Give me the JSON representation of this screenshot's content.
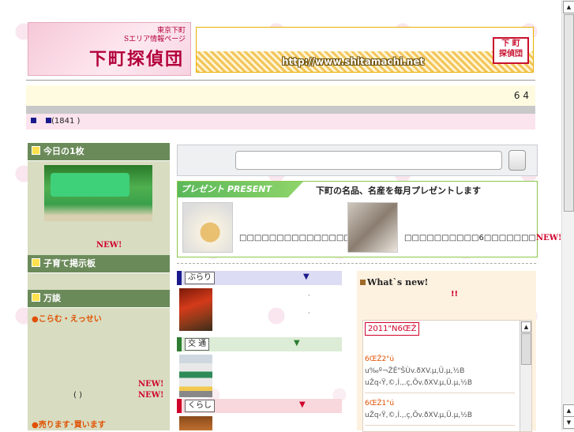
{
  "header": {
    "logo_sub_line1": "東京下町",
    "logo_sub_line2": "Sエリア情報ページ",
    "logo_main": "下町探偵団",
    "banner_url": "http://www.shitamachi.net",
    "banner_stamp_line1": "下 町",
    "banner_stamp_line2": "探偵団"
  },
  "counter": {
    "value": "6 4"
  },
  "info_bar": {
    "text": "(1841 )"
  },
  "left": {
    "today_title": "今日の1枚",
    "today_new": "NEW!",
    "board_title": "子育て掲示板",
    "talk_title": "万談",
    "column_label": "●こらむ・えっせい",
    "new1": "NEW!",
    "new2": "NEW!",
    "paren": "(     )",
    "sell_label": "●売ります･買います"
  },
  "search": {
    "value": "",
    "placeholder": ""
  },
  "present": {
    "label": "プレゼント PRESENT",
    "desc": "下町の名品、名産を毎月プレゼントします",
    "item1_caption": "□□□□□□□□□□□□□□□□□□□",
    "item2_caption_a": "□□□□□□□□□□6□□□□□□□",
    "item2_new": "NEW!"
  },
  "categories": [
    {
      "name": "ぶらり",
      "color": "#1a1a8c",
      "band": "#dcdcf4"
    },
    {
      "name": "交 通",
      "color": "#2e7d32",
      "band": "#dcecd6"
    },
    {
      "name": "くらし",
      "color": "#d0002a",
      "band": "#f8d8dc"
    }
  ],
  "whats_new": {
    "title": "What`s new!",
    "excl": "!!",
    "year": "2011\"N6ŒŽ",
    "lines": [
      {
        "text": "6ŒŽ2\"ú",
        "style": "or"
      },
      {
        "text": "u‰º¬ŽÊ\"ŠÙv.ðXV.µ,Ü.µ,½B",
        "style": ""
      },
      {
        "text": "uŽq‹Ÿ,©,Í.,.ç,Õv.ðXV.µ,Ü.µ,½B",
        "style": ""
      },
      {
        "text": "6ŒŽ1\"ú",
        "style": "or"
      },
      {
        "text": "uŽq‹Ÿ,©,Í.,.ç,Õv.ðXV.µ,Ü.µ,½B",
        "style": ""
      }
    ]
  },
  "colors": {
    "accent_green": "#6b8a5a",
    "accent_pink": "#fbe4ee",
    "new_red": "#d0002a"
  }
}
